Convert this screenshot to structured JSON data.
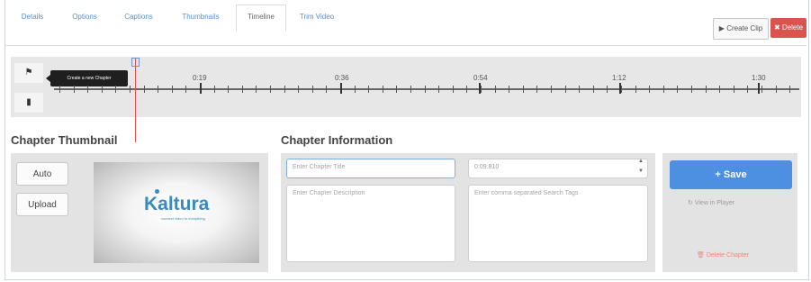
{
  "tabs": [
    {
      "label": "Details",
      "active": false
    },
    {
      "label": "Options",
      "active": false
    },
    {
      "label": "Captions",
      "active": false
    },
    {
      "label": "Thumbnails",
      "active": false
    },
    {
      "label": "Timeline",
      "active": true
    },
    {
      "label": "Trim Video",
      "active": false
    }
  ],
  "header_buttons": {
    "create_clip": "Create Clip",
    "delete": "Delete"
  },
  "timeline": {
    "add_chapter_tooltip": "Create a new Chapter",
    "tick_labels": [
      "0:19",
      "0:36",
      "0:54",
      "1:12",
      "1:30"
    ],
    "playhead_time_fraction": 0.12,
    "icons": [
      "bookmark-icon",
      "file-icon"
    ]
  },
  "thumbnail": {
    "title": "Chapter Thumbnail",
    "auto_label": "Auto",
    "upload_label": "Upload",
    "logo_text": "Kaltura",
    "logo_subtext": "connect video to everything"
  },
  "chapter_info": {
    "title": "Chapter Information",
    "title_placeholder": "Enter Chapter Title",
    "time_value": "0:09.810",
    "description_placeholder": "Enter Chapter Description",
    "tags_placeholder": "Enter comma separated Search Tags"
  },
  "actions": {
    "save_label": "Save",
    "view_in_player": "View in Player",
    "delete_chapter": "Delete Chapter"
  },
  "colors": {
    "accent": "#4d8fe0",
    "danger": "#d9534f",
    "playhead": "#e05050",
    "tab_link": "#5a8fc8"
  }
}
